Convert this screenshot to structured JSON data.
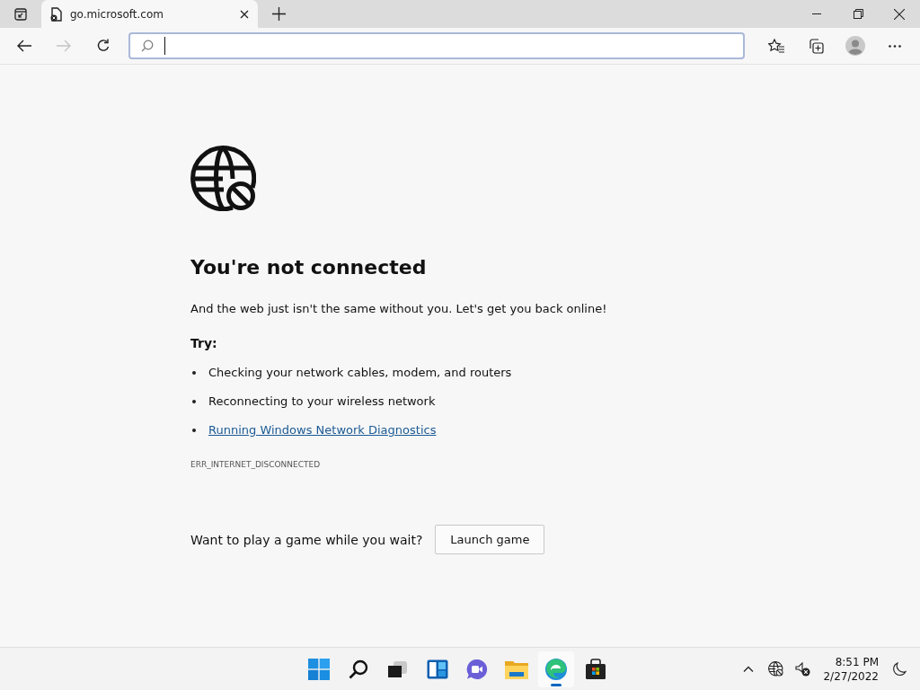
{
  "tab": {
    "title": "go.microsoft.com",
    "selected": true
  },
  "toolbar": {
    "back_disabled": false,
    "forward_disabled": true
  },
  "page": {
    "heading": "You're not connected",
    "message": "And the web just isn't the same without you. Let's get you back online!",
    "try_label": "Try:",
    "suggestions": [
      {
        "text": "Checking your network cables, modem, and routers",
        "kind": "text"
      },
      {
        "text": "Reconnecting to your wireless network",
        "kind": "text"
      },
      {
        "text": "Running Windows Network Diagnostics",
        "kind": "link"
      }
    ],
    "error_code": "ERR_INTERNET_DISCONNECTED",
    "game_prompt": "Want to play a game while you wait?",
    "game_button": "Launch game"
  },
  "taskbar": {
    "apps": [
      {
        "kind": "start",
        "selected": false
      },
      {
        "kind": "search",
        "selected": false
      },
      {
        "kind": "taskview",
        "selected": false
      },
      {
        "kind": "widgets",
        "selected": false
      },
      {
        "kind": "chat",
        "selected": false
      },
      {
        "kind": "explorer",
        "selected": false
      },
      {
        "kind": "edge",
        "selected": true
      },
      {
        "kind": "store",
        "selected": false
      }
    ],
    "time": "8:51 PM",
    "date": "2/27/2022"
  }
}
